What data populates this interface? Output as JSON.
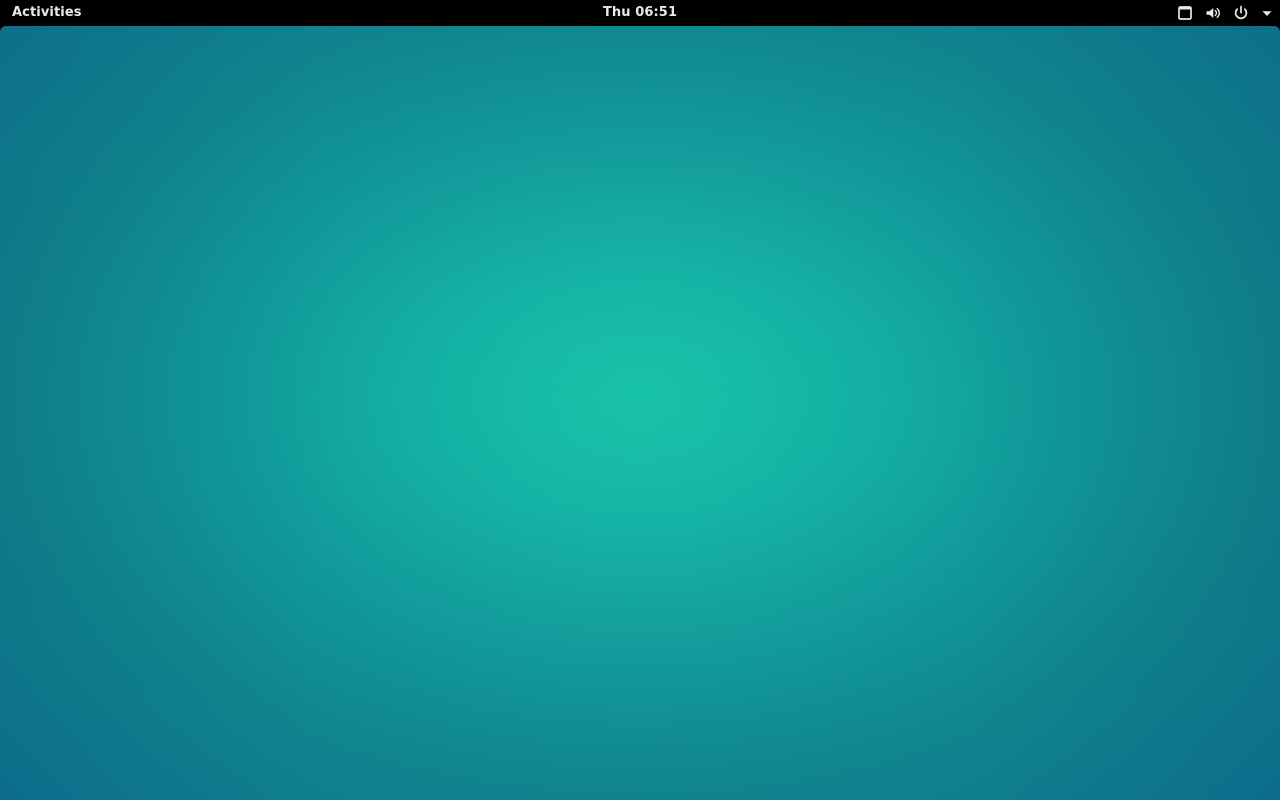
{
  "top_bar": {
    "activities_label": "Activities",
    "clock": "Thu 06:51",
    "icons": {
      "window": "window-icon",
      "volume": "volume-icon",
      "power": "power-icon",
      "dropdown": "chevron-down-icon"
    }
  },
  "desktop": {
    "background_colors": {
      "center": "#12c1a7",
      "edge": "#0d7392",
      "top_bar": "#000000",
      "text": "#e8e8e8"
    }
  }
}
